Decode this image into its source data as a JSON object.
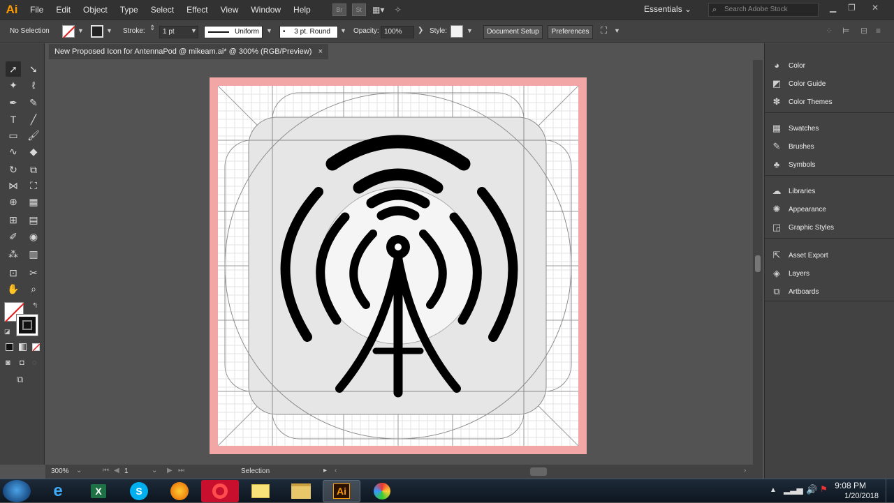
{
  "app": {
    "logo": "Ai"
  },
  "menu": [
    "File",
    "Edit",
    "Object",
    "Type",
    "Select",
    "Effect",
    "View",
    "Window",
    "Help"
  ],
  "menubar_icons": {
    "bridge": "Br",
    "stock": "St"
  },
  "workspace": "Essentials",
  "search_stock_placeholder": "Search Adobe Stock",
  "control_bar": {
    "selection_status": "No Selection",
    "stroke_label": "Stroke:",
    "stroke_weight": "1 pt",
    "profile": "Uniform",
    "brush": "3 pt. Round",
    "opacity_label": "Opacity:",
    "opacity_value": "100%",
    "style_label": "Style:",
    "document_setup": "Document Setup",
    "preferences": "Preferences"
  },
  "document_tab": {
    "title": "New Proposed Icon for AntennaPod @ mikeam.ai* @ 300% (RGB/Preview)",
    "close": "×"
  },
  "status_bar": {
    "zoom": "300%",
    "artboard": "1",
    "tool": "Selection"
  },
  "panels": [
    [
      {
        "label": "Color",
        "icon": "color-icon"
      },
      {
        "label": "Color Guide",
        "icon": "color-guide-icon"
      },
      {
        "label": "Color Themes",
        "icon": "color-themes-icon"
      }
    ],
    [
      {
        "label": "Swatches",
        "icon": "swatches-icon"
      },
      {
        "label": "Brushes",
        "icon": "brushes-icon"
      },
      {
        "label": "Symbols",
        "icon": "symbols-icon"
      }
    ],
    [
      {
        "label": "Libraries",
        "icon": "libraries-icon"
      },
      {
        "label": "Appearance",
        "icon": "appearance-icon"
      },
      {
        "label": "Graphic Styles",
        "icon": "graphic-styles-icon"
      }
    ],
    [
      {
        "label": "Asset Export",
        "icon": "asset-export-icon"
      },
      {
        "label": "Layers",
        "icon": "layers-icon"
      },
      {
        "label": "Artboards",
        "icon": "artboards-icon"
      }
    ]
  ],
  "taskbar": {
    "apps": [
      "internet-explorer",
      "excel",
      "skype",
      "firefox",
      "opera",
      "sticky-notes",
      "file-explorer",
      "illustrator",
      "paint"
    ],
    "illustrator_label": "Ai",
    "clock_time": "9:08 PM",
    "clock_date": "1/20/2018"
  },
  "colors": {
    "accent": "#ff9a00",
    "artboard_bleed": "#f2a6a6",
    "ui_dark": "#323232",
    "ui_mid": "#424242",
    "canvas": "#535353"
  }
}
